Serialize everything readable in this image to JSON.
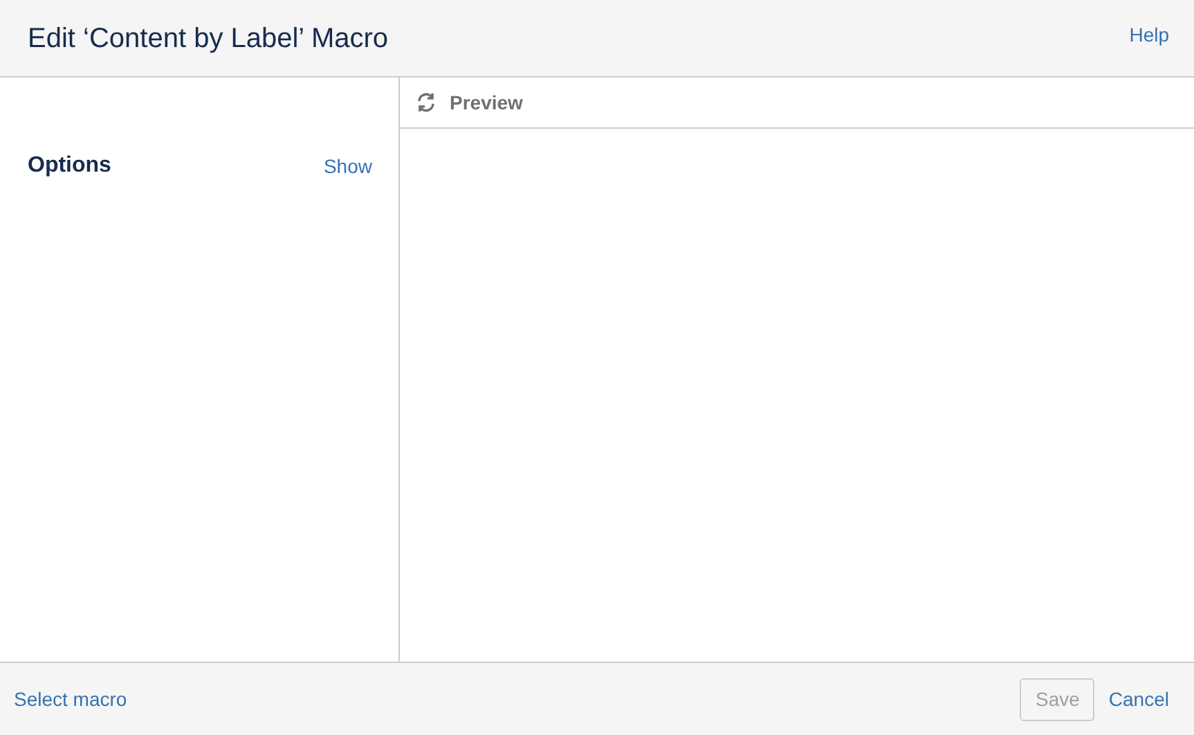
{
  "dialog": {
    "title": "Edit ‘Content by Label’ Macro",
    "help_link": "Help"
  },
  "options": {
    "label": "Options",
    "toggle": "Show"
  },
  "preview": {
    "label": "Preview"
  },
  "footer": {
    "select_macro": "Select macro",
    "buttons": [
      {
        "kind": "primary",
        "label": "Save",
        "disabled": true
      },
      {
        "kind": "link",
        "label": "Cancel",
        "disabled": false
      }
    ]
  }
}
